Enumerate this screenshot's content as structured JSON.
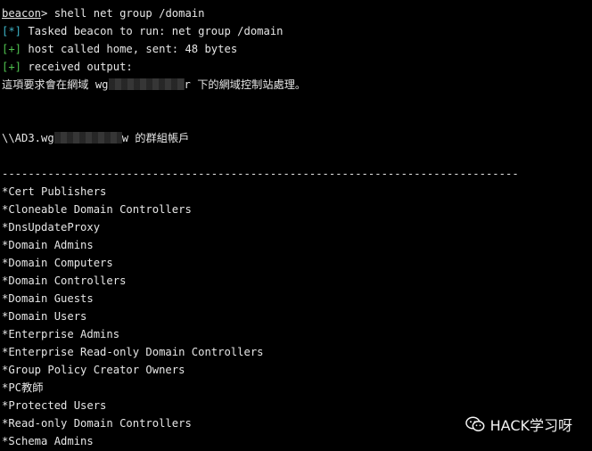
{
  "terminal": {
    "command": {
      "prompt": "beacon",
      "text": "> shell net group /domain"
    },
    "status": [
      {
        "tag": "[*]",
        "text": " Tasked beacon to run: net group /domain",
        "tag_color": "#3db3c7"
      },
      {
        "tag": "[+]",
        "text": " host called home, sent: 48 bytes",
        "tag_color": "#4ec04e"
      },
      {
        "tag": "[+]",
        "text": " received output:",
        "tag_color": "#4ec04e"
      }
    ],
    "request_line": {
      "prefix": "這項要求會在網域 wg",
      "suffix": "r 下的網域控制站處理。"
    },
    "server_line": {
      "prefix": "\\\\AD3.wg",
      "suffix": "w 的群組帳戶"
    },
    "separator": "-------------------------------------------------------------------------------",
    "groups": [
      "*Cert Publishers",
      "*Cloneable Domain Controllers",
      "*DnsUpdateProxy",
      "*Domain Admins",
      "*Domain Computers",
      "*Domain Controllers",
      "*Domain Guests",
      "*Domain Users",
      "*Enterprise Admins",
      "*Enterprise Read-only Domain Controllers",
      "*Group Policy Creator Owners",
      "*PC教師",
      "*Protected Users",
      "*Read-only Domain Controllers",
      "*Schema Admins"
    ]
  },
  "watermark": {
    "icon": "wechat-icon",
    "text": "HACK学习呀"
  }
}
